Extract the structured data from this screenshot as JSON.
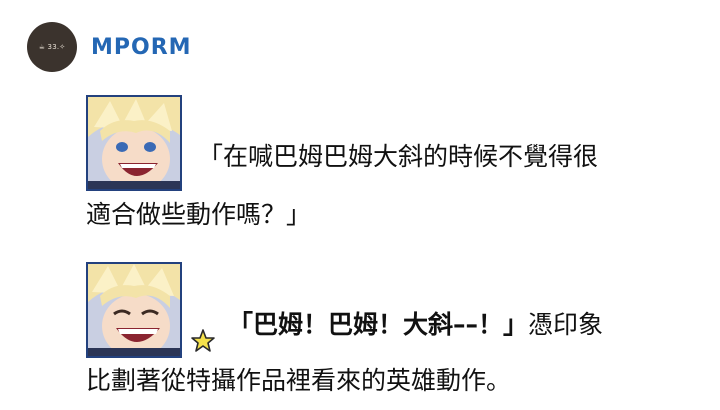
{
  "header": {
    "avatar_text": "☕ 33.✧",
    "username": "MPORM"
  },
  "posts": [
    {
      "sticker_icon": "laughing-blond-hero-sticker",
      "line_a": "「在喊巴姆巴姆大斜的時候不覺得很",
      "line_b": "適合做些動作嗎？」"
    },
    {
      "sticker_icon": "grinning-blond-hero-sticker",
      "star_icon": "sparkle-star-icon",
      "quote": "「巴姆！巴姆！大斜––！」",
      "line_a_rest": "憑印象",
      "line_b": "比劃著從特攝作品裡看來的英雄動作。"
    }
  ],
  "colors": {
    "username": "#2467b4",
    "avatar_bg": "#3b332d",
    "sticker_border": "#23417e",
    "star": "#f5e14b"
  }
}
